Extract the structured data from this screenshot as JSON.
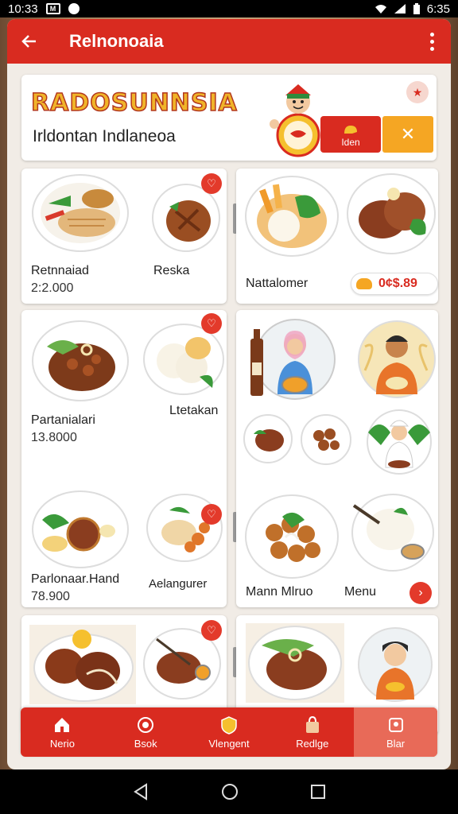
{
  "status_bar": {
    "time": "10:33",
    "box_icon_text": "M",
    "battery_text": "6:35"
  },
  "appbar": {
    "title": "Relnonoaia"
  },
  "header": {
    "brand": "RADOSUNNSIA",
    "subtitle": "Irldontan Indlaneoa",
    "red_button_label": "Iden",
    "close_symbol": "✕"
  },
  "cards": [
    {
      "labels": [
        "Retnnaiad",
        "Reska"
      ],
      "prices": [
        "2:2.000"
      ]
    },
    {
      "labels": [
        "Nattalomer"
      ],
      "price_pill": "0¢$.89"
    },
    {
      "labels": [
        "Partanialari",
        "Ltetakan"
      ],
      "prices": [
        "13.8000"
      ]
    },
    {
      "labels": [
        "Parlonaar.Hand",
        "Aelangurer"
      ],
      "prices": [
        "78.900"
      ]
    },
    {
      "labels": [
        "Mann Mlruo",
        "Menu"
      ]
    }
  ],
  "bottom_nav": [
    {
      "label": "Nerio",
      "icon": "home-icon"
    },
    {
      "label": "Bsok",
      "icon": "book-icon"
    },
    {
      "label": "Vlengent",
      "icon": "shield-icon"
    },
    {
      "label": "Redlge",
      "icon": "bag-icon"
    },
    {
      "label": "Blar",
      "icon": "profile-icon"
    }
  ],
  "colors": {
    "primary": "#d92b20",
    "accent": "#f5a623",
    "background": "#f1ece6"
  }
}
